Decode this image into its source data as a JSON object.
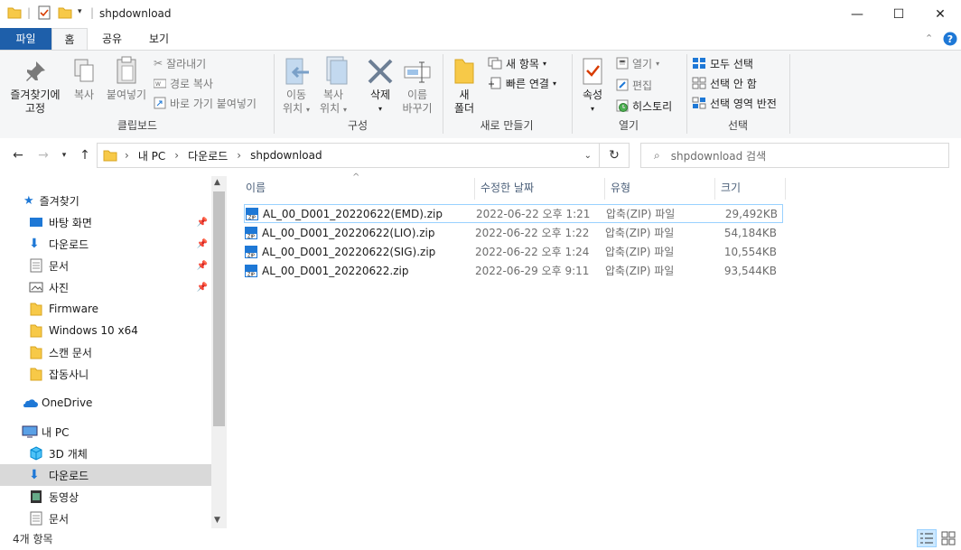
{
  "window": {
    "title": "shpdownload",
    "minimize": "—",
    "maximize": "☐",
    "close": "✕"
  },
  "ribbon_tabs": [
    {
      "label": "파일"
    },
    {
      "label": "홈"
    },
    {
      "label": "공유"
    },
    {
      "label": "보기"
    }
  ],
  "ribbon": {
    "clipboard": {
      "pin_quick": "즐겨찾기에\n고정",
      "pin_quick_l1": "즐겨찾기에",
      "pin_quick_l2": "고정",
      "copy": "복사",
      "paste": "붙여넣기",
      "cut": "잘라내기",
      "copy_path": "경로 복사",
      "paste_shortcut": "바로 가기 붙여넣기",
      "label": "클립보드"
    },
    "organize": {
      "move_l1": "이동",
      "move_l2": "위치",
      "copy_l1": "복사",
      "copy_l2": "위치",
      "delete": "삭제",
      "rename_l1": "이름",
      "rename_l2": "바꾸기",
      "label": "구성"
    },
    "new": {
      "new_folder_l1": "새",
      "new_folder_l2": "폴더",
      "new_item": "새 항목",
      "easy_access": "빠른 연결",
      "label": "새로 만들기"
    },
    "open": {
      "properties": "속성",
      "open": "열기",
      "edit": "편집",
      "history": "히스토리",
      "label": "열기"
    },
    "select": {
      "select_all": "모두 선택",
      "select_none": "선택 안 함",
      "invert": "선택 영역 반전",
      "label": "선택"
    }
  },
  "address": {
    "crumbs": [
      "내 PC",
      "다운로드",
      "shpdownload"
    ],
    "search_placeholder": "shpdownload 검색"
  },
  "nav": {
    "quick_access": "즐겨찾기",
    "quick_items": [
      {
        "label": "바탕 화면",
        "pinned": true
      },
      {
        "label": "다운로드",
        "pinned": true
      },
      {
        "label": "문서",
        "pinned": true
      },
      {
        "label": "사진",
        "pinned": true
      },
      {
        "label": "Firmware",
        "pinned": false
      },
      {
        "label": "Windows 10 x64",
        "pinned": false
      },
      {
        "label": "스캔 문서",
        "pinned": false
      },
      {
        "label": "잡동사니",
        "pinned": false
      }
    ],
    "onedrive": "OneDrive",
    "this_pc": "내 PC",
    "pc_items": [
      {
        "label": "3D 개체"
      },
      {
        "label": "다운로드"
      },
      {
        "label": "동영상"
      },
      {
        "label": "문서"
      }
    ]
  },
  "columns": {
    "name": "이름",
    "date": "수정한 날짜",
    "type": "유형",
    "size": "크기"
  },
  "files": [
    {
      "name": "AL_00_D001_20220622(EMD).zip",
      "date": "2022-06-22 오후 1:21",
      "type": "압축(ZIP) 파일",
      "size": "29,492KB"
    },
    {
      "name": "AL_00_D001_20220622(LIO).zip",
      "date": "2022-06-22 오후 1:22",
      "type": "압축(ZIP) 파일",
      "size": "54,184KB"
    },
    {
      "name": "AL_00_D001_20220622(SIG).zip",
      "date": "2022-06-22 오후 1:24",
      "type": "압축(ZIP) 파일",
      "size": "10,554KB"
    },
    {
      "name": "AL_00_D001_20220622.zip",
      "date": "2022-06-29 오후 9:11",
      "type": "압축(ZIP) 파일",
      "size": "93,544KB"
    }
  ],
  "status": {
    "count": "4개 항목"
  },
  "colors": {
    "file_tab": "#1e5faa",
    "accent": "#0078d7",
    "selection": "#d9d9d9"
  }
}
